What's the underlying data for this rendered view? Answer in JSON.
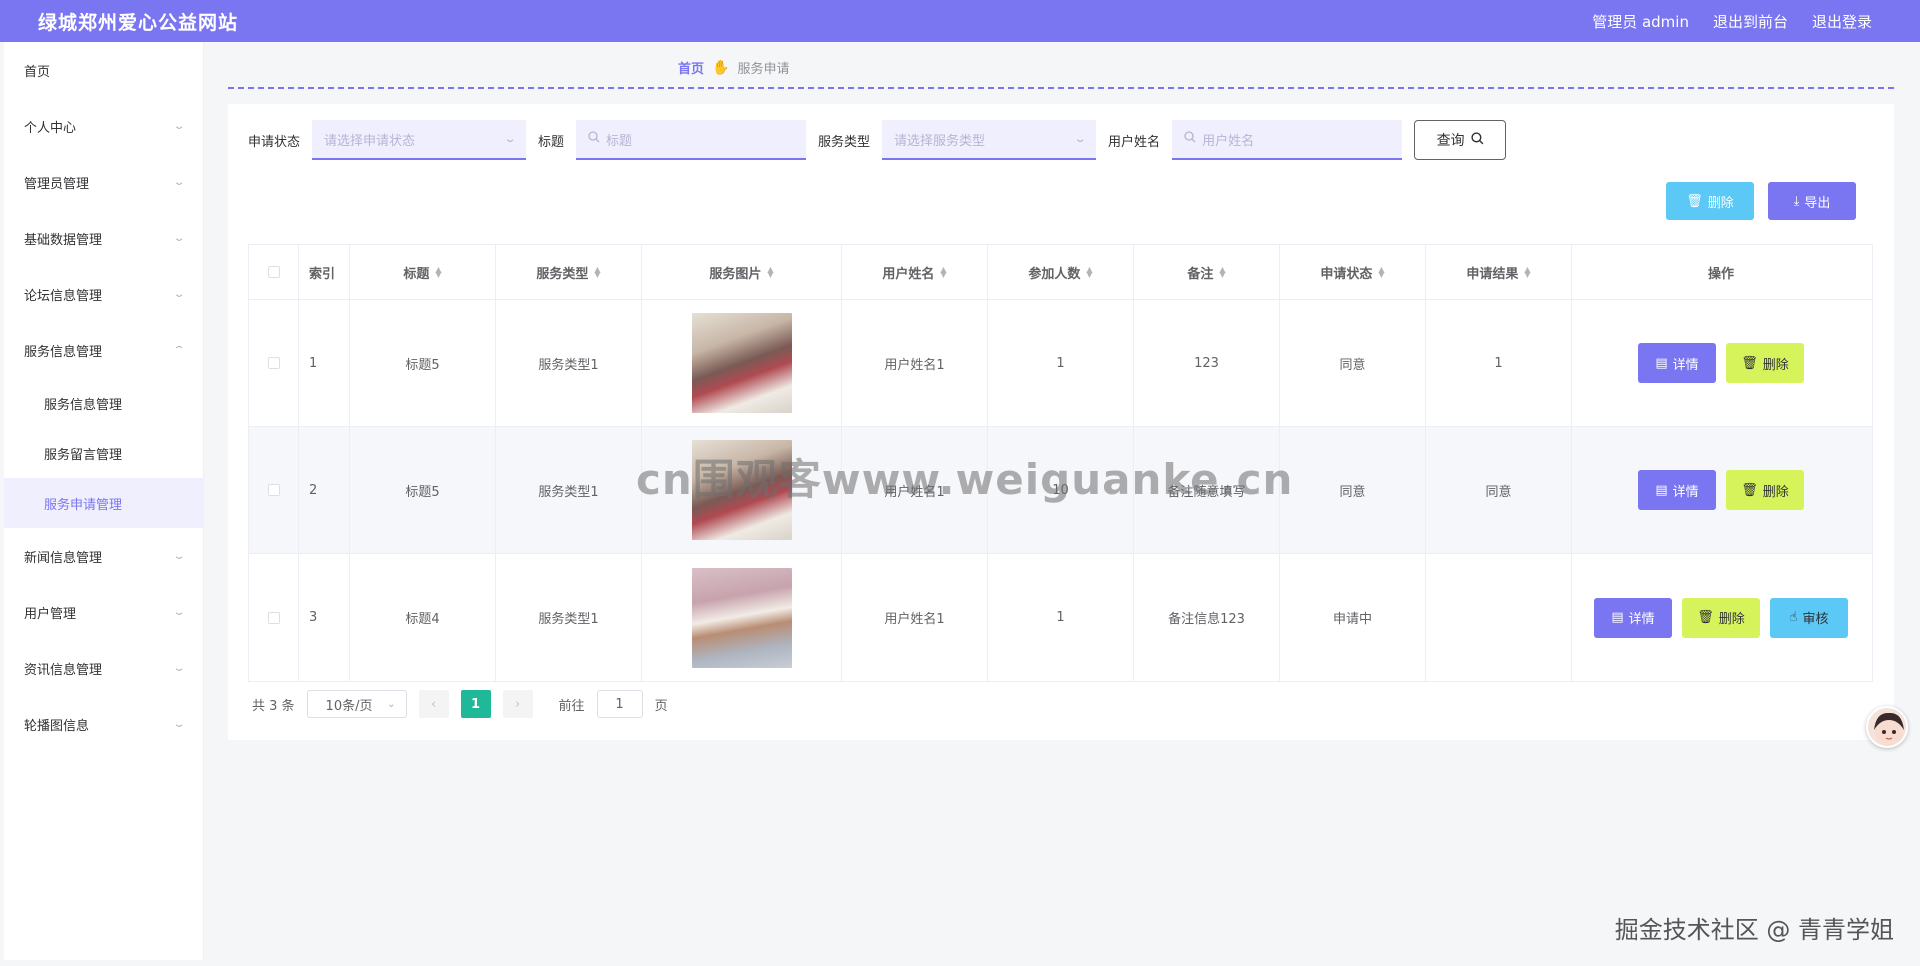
{
  "header": {
    "site_title": "绿城郑州爱心公益网站",
    "admin_label": "管理员 admin",
    "to_front": "退出到前台",
    "logout": "退出登录"
  },
  "sidebar": {
    "items": [
      {
        "label": "首页"
      },
      {
        "label": "个人中心"
      },
      {
        "label": "管理员管理"
      },
      {
        "label": "基础数据管理"
      },
      {
        "label": "论坛信息管理"
      },
      {
        "label": "服务信息管理"
      },
      {
        "label": "新闻信息管理"
      },
      {
        "label": "用户管理"
      },
      {
        "label": "资讯信息管理"
      },
      {
        "label": "轮播图信息"
      }
    ],
    "subitems": [
      {
        "label": "服务信息管理"
      },
      {
        "label": "服务留言管理"
      },
      {
        "label": "服务申请管理"
      }
    ]
  },
  "breadcrumb": {
    "home": "首页",
    "current": "服务申请"
  },
  "filters": {
    "status_label": "申请状态",
    "status_placeholder": "请选择申请状态",
    "title_label": "标题",
    "title_placeholder": "标题",
    "type_label": "服务类型",
    "type_placeholder": "请选择服务类型",
    "user_label": "用户姓名",
    "user_placeholder": "用户姓名",
    "search_button": "查询"
  },
  "actions": {
    "delete": "删除",
    "export": "导出"
  },
  "table": {
    "headers": [
      "索引",
      "标题",
      "服务类型",
      "服务图片",
      "用户姓名",
      "参加人数",
      "备注",
      "申请状态",
      "申请结果",
      "操作"
    ],
    "rows": [
      {
        "index": "1",
        "title": "标题5",
        "type": "服务类型1",
        "user": "用户姓名1",
        "count": "1",
        "note": "123",
        "status": "同意",
        "result": "1"
      },
      {
        "index": "2",
        "title": "标题5",
        "type": "服务类型1",
        "user": "用户姓名1",
        "count": "10",
        "note": "备注随意填写",
        "status": "同意",
        "result": "同意"
      },
      {
        "index": "3",
        "title": "标题4",
        "type": "服务类型1",
        "user": "用户姓名1",
        "count": "1",
        "note": "备注信息123",
        "status": "申请中",
        "result": ""
      }
    ],
    "op_detail": "详情",
    "op_delete": "删除",
    "op_audit": "审核"
  },
  "pagination": {
    "total": "共 3 条",
    "page_size": "10条/页",
    "current_page": "1",
    "goto_label": "前往",
    "goto_value": "1",
    "page_unit": "页"
  },
  "overlay": {
    "watermark": "cn围观客www.weiguanke.cn",
    "credit": "掘金技术社区 @ 青青学姐"
  },
  "colors": {
    "primary": "#7a75f0",
    "lime": "#d7f35c",
    "sky": "#5bc8f5",
    "pager_active": "#1fb99a"
  }
}
